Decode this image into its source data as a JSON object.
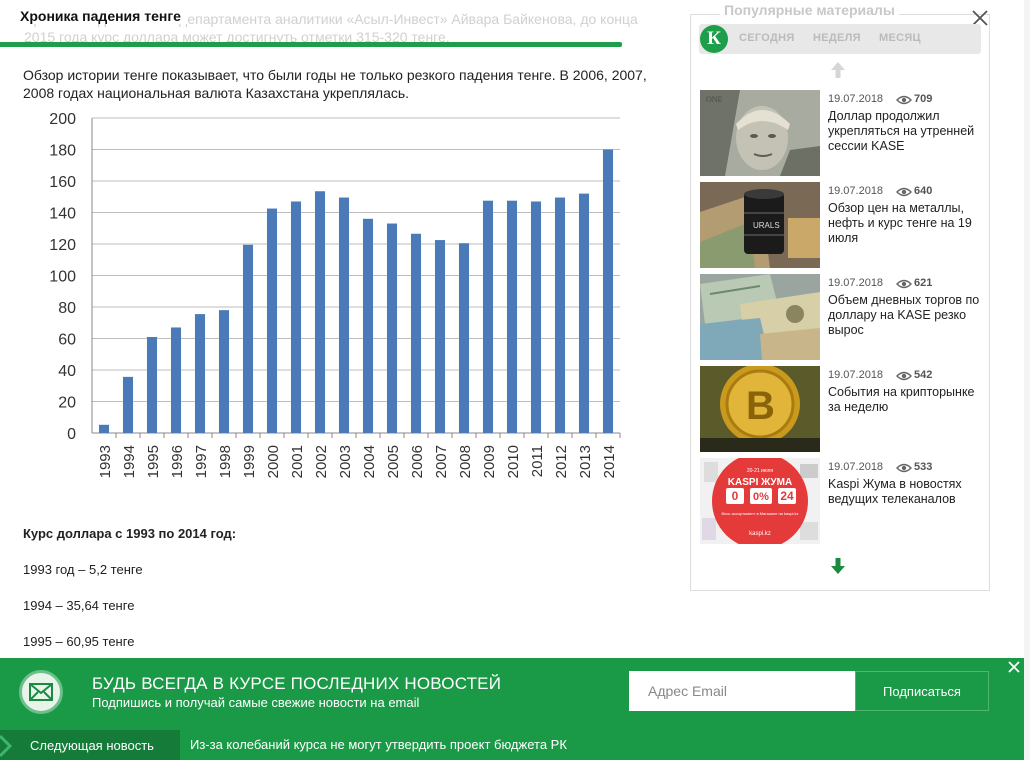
{
  "article": {
    "faded_text": "Хроника падения тенге департамента аналитики «Асыл-Инвест» Айвара Байкенова, до конца 2015 года курс доллара может достигнуть отметки 315-320 тенге.",
    "title": "Хроника падения тенге",
    "intro": "Обзор истории тенге показывает, что были годы не только резкого падения тенге. В 2006, 2007, 2008 годах национальная валюта Казахстана укреплялась.",
    "rates_title": "Курс доллара с 1993 по 2014 год:",
    "rates": [
      "1993 год – 5,2 тенге",
      "1994 – 35,64 тенге",
      "1995 – 60,95 тенге"
    ]
  },
  "chart_data": {
    "type": "bar",
    "categories": [
      "1993",
      "1994",
      "1995",
      "1996",
      "1997",
      "1998",
      "1999",
      "2000",
      "2001",
      "2002",
      "2003",
      "2004",
      "2005",
      "2006",
      "2007",
      "2008",
      "2009",
      "2010",
      "2011",
      "2012",
      "2013",
      "2014"
    ],
    "values": [
      5.2,
      35.64,
      60.95,
      67,
      75.5,
      78,
      119.5,
      142.5,
      147,
      153.5,
      149.5,
      136,
      133,
      126.5,
      122.5,
      120.5,
      147.5,
      147.5,
      147,
      149.5,
      152,
      180
    ],
    "ylim": [
      0,
      200
    ],
    "yticks": [
      "0",
      "20",
      "40",
      "60",
      "80",
      "100",
      "120",
      "140",
      "160",
      "180",
      "200"
    ],
    "grid": true,
    "bar_color": "#4a7ab8"
  },
  "popular": {
    "title": "Популярные материалы",
    "logo_letter": "К",
    "tabs": [
      "СЕГОДНЯ",
      "НЕДЕЛЯ",
      "МЕСЯЦ"
    ],
    "items": [
      {
        "date": "19.07.2018",
        "views": "709",
        "title": "Доллар продолжил укрепляться на утренней сессии KASE",
        "thumb": "dollar-portrait"
      },
      {
        "date": "19.07.2018",
        "views": "640",
        "title": "Обзор цен на металлы, нефть и курс тенге на 19 июля",
        "thumb": "oil-barrel"
      },
      {
        "date": "19.07.2018",
        "views": "621",
        "title": "Объем дневных торгов по доллару на KASE резко вырос",
        "thumb": "banknotes"
      },
      {
        "date": "19.07.2018",
        "views": "542",
        "title": "События на крипторынке за неделю",
        "thumb": "bitcoin"
      },
      {
        "date": "19.07.2018",
        "views": "533",
        "title": "Kaspi Жума в новостях ведущих телеканалов",
        "thumb": "kaspi-promo"
      }
    ],
    "kaspi": {
      "top": "20-21 июля",
      "brand": "KASPI ЖУМА",
      "digits": [
        "0",
        "0%",
        "24"
      ],
      "small": "Весь ассортимент в Магазине на kaspi.kz",
      "site": "kaspi.kz"
    }
  },
  "newsletter": {
    "heading": "БУДЬ ВСЕГДА В КУРСЕ ПОСЛЕДНИХ НОВОСТЕЙ",
    "subheading": "Подпишись и получай самые свежие новости на email",
    "email_placeholder": "Адрес Email",
    "subscribe_label": "Подписаться"
  },
  "nextbar": {
    "label": "Следующая новость",
    "title": "Из-за колебаний курса не могут утвердить проект бюджета РК"
  },
  "colors": {
    "accent": "#1a9a47",
    "bar": "#4a7ab8"
  }
}
